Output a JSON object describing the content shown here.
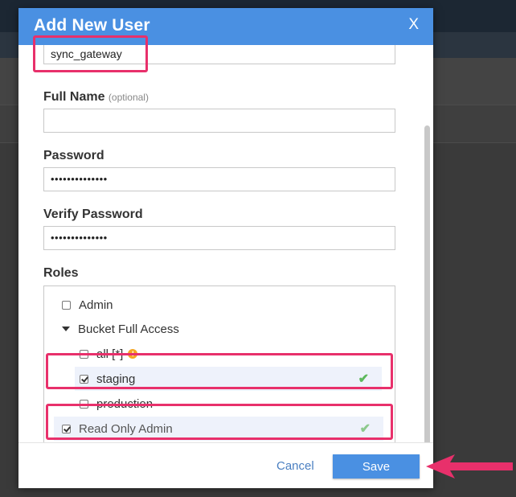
{
  "dialog": {
    "title": "Add New User",
    "close_label": "X"
  },
  "form": {
    "username_value": "sync_gateway",
    "full_name": {
      "label": "Full Name",
      "optional": "(optional)",
      "value": ""
    },
    "password": {
      "label": "Password",
      "masked_value": "••••••••••••••"
    },
    "verify_password": {
      "label": "Verify Password",
      "masked_value": "••••••••••••••"
    },
    "roles_label": "Roles"
  },
  "roles": {
    "admin": {
      "label": "Admin",
      "checked": false
    },
    "bucket_full_access": {
      "label": "Bucket Full Access",
      "expanded": true,
      "items": [
        {
          "label": "all [*]",
          "checked": false,
          "warning": true
        },
        {
          "label": "staging",
          "checked": true
        },
        {
          "label": "production",
          "checked": false
        }
      ]
    },
    "read_only_admin": {
      "label": "Read Only Admin",
      "checked": true
    }
  },
  "footer": {
    "cancel_label": "Cancel",
    "save_label": "Save"
  },
  "colors": {
    "header_blue": "#4a90e2",
    "annotation_pink": "#e8306b",
    "check_green": "#5cb85c",
    "warning_orange": "#f5a623"
  }
}
